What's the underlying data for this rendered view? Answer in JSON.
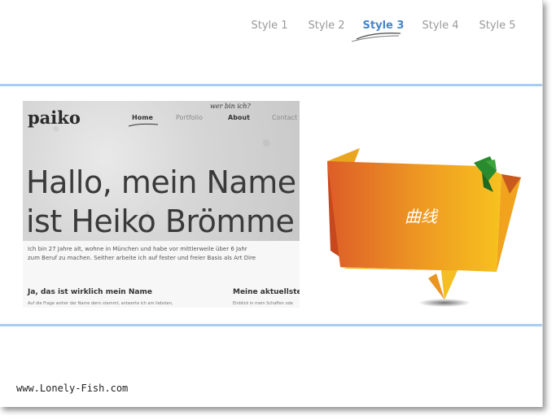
{
  "nav": {
    "items": [
      "Style 1",
      "Style 2",
      "Style 3",
      "Style 4",
      "Style 5"
    ],
    "active_index": 2
  },
  "preview": {
    "logo": "paiko",
    "handwriting": "wer bin ich?",
    "menu": [
      "Home",
      "Portfolio",
      "About",
      "Contact"
    ],
    "headline_1": "Hallo, mein Name",
    "headline_2": "ist Heiko Brömme",
    "paragraph_1": "Ich bin 27 Jahre alt, wohne in München und habe vor mittlerweile über 6 Jahr",
    "paragraph_2": "zum Beruf zu machen. Seither arbeite ich auf fester und freier Basis als Art Dire",
    "col1_title": "Ja, das ist wirklich mein Name",
    "col1_text": "Auf die Frage woher der Name denn stammt, antworte ich am liebsten,",
    "col2_title": "Meine aktuellster",
    "col2_text": "Einblick in mein Schaffen ode"
  },
  "banner": {
    "label": "曲线",
    "colors": {
      "orange_dark": "#e0612a",
      "orange_light": "#f6b91f",
      "green": "#2a8a2e"
    }
  },
  "footer": {
    "text": "www.Lonely-Fish.com"
  },
  "colors": {
    "accent_line": "#a8cdf4",
    "active_nav": "#4a84c9"
  }
}
